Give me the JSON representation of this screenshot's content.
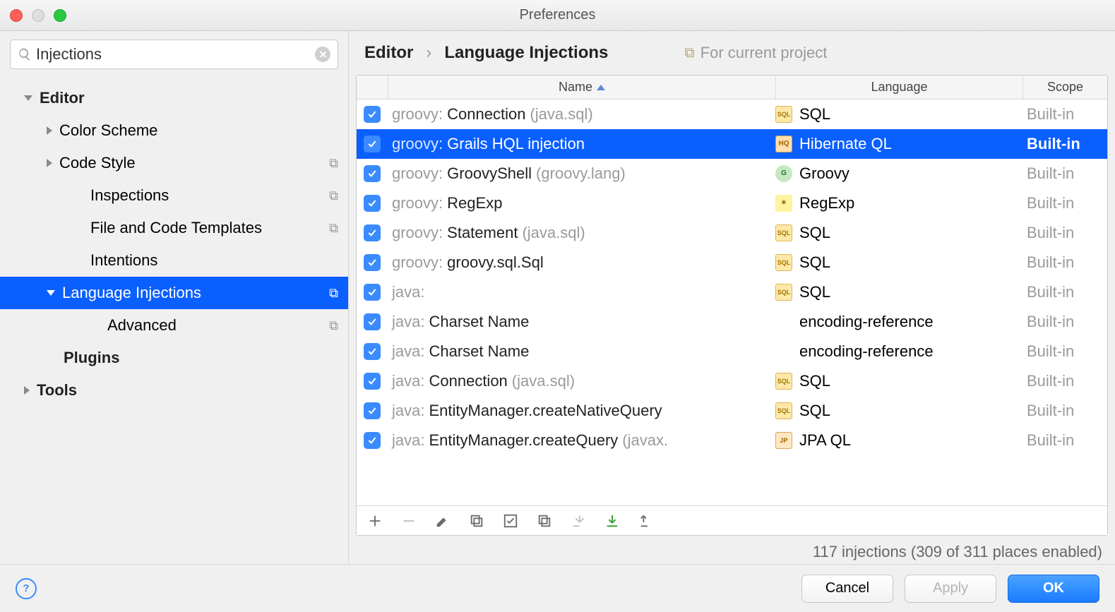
{
  "window": {
    "title": "Preferences"
  },
  "search": {
    "value": "Injections"
  },
  "tree": {
    "items": [
      {
        "label": "Editor",
        "bold": true,
        "arrow": "down",
        "indent": 0,
        "projIcon": false
      },
      {
        "label": "Color Scheme",
        "bold": false,
        "arrow": "right",
        "indent": 1,
        "projIcon": false
      },
      {
        "label": "Code Style",
        "bold": false,
        "arrow": "right",
        "indent": 1,
        "projIcon": true
      },
      {
        "label": "Inspections",
        "bold": false,
        "arrow": "none",
        "indent": 2,
        "projIcon": true
      },
      {
        "label": "File and Code Templates",
        "bold": false,
        "arrow": "none",
        "indent": 2,
        "projIcon": true
      },
      {
        "label": "Intentions",
        "bold": false,
        "arrow": "none",
        "indent": 2,
        "projIcon": false
      },
      {
        "label": "Language Injections",
        "bold": false,
        "arrow": "down",
        "indent": 1,
        "projIcon": true,
        "selected": true
      },
      {
        "label": "Advanced",
        "bold": false,
        "arrow": "none",
        "indent": 3,
        "projIcon": true
      },
      {
        "label": "Plugins",
        "bold": true,
        "arrow": "none",
        "indent": 0,
        "projIcon": false,
        "indentOverride": 1
      },
      {
        "label": "Tools",
        "bold": true,
        "arrow": "right",
        "indent": 0,
        "projIcon": false
      }
    ]
  },
  "breadcrumb": {
    "part1": "Editor",
    "part2": "Language Injections",
    "projectHint": "For current project"
  },
  "columns": {
    "name": "Name",
    "language": "Language",
    "scope": "Scope"
  },
  "rows": [
    {
      "prefix": "groovy:",
      "name": "Connection",
      "paren": "(java.sql)",
      "lang": "SQL",
      "icon": "sql",
      "scope": "Built-in"
    },
    {
      "prefix": "groovy:",
      "name": "Grails HQL injection",
      "paren": "",
      "lang": "Hibernate QL",
      "icon": "hql",
      "scope": "Built-in",
      "selected": true
    },
    {
      "prefix": "groovy:",
      "name": "GroovyShell",
      "paren": "(groovy.lang)",
      "lang": "Groovy",
      "icon": "groovy",
      "scope": "Built-in"
    },
    {
      "prefix": "groovy:",
      "name": "RegExp",
      "paren": "",
      "lang": "RegExp",
      "icon": "regex",
      "scope": "Built-in"
    },
    {
      "prefix": "groovy:",
      "name": "Statement",
      "paren": "(java.sql)",
      "lang": "SQL",
      "icon": "sql",
      "scope": "Built-in"
    },
    {
      "prefix": "groovy:",
      "name": "groovy.sql.Sql",
      "paren": "",
      "lang": "SQL",
      "icon": "sql",
      "scope": "Built-in"
    },
    {
      "prefix": "java:",
      "name": "",
      "paren": "",
      "lang": "SQL",
      "icon": "sql",
      "scope": "Built-in"
    },
    {
      "prefix": "java:",
      "name": "Charset Name",
      "paren": "",
      "lang": "encoding-reference",
      "icon": "none",
      "scope": "Built-in"
    },
    {
      "prefix": "java:",
      "name": "Charset Name",
      "paren": "",
      "lang": "encoding-reference",
      "icon": "none",
      "scope": "Built-in"
    },
    {
      "prefix": "java:",
      "name": "Connection",
      "paren": "(java.sql)",
      "lang": "SQL",
      "icon": "sql",
      "scope": "Built-in"
    },
    {
      "prefix": "java:",
      "name": "EntityManager.createNativeQuery",
      "paren": "",
      "lang": "SQL",
      "icon": "sql",
      "scope": "Built-in"
    },
    {
      "prefix": "java:",
      "name": "EntityManager.createQuery",
      "paren": "(javax.",
      "lang": "JPA QL",
      "icon": "jpa",
      "scope": "Built-in"
    }
  ],
  "status": "117 injections (309 of 311 places enabled)",
  "buttons": {
    "cancel": "Cancel",
    "apply": "Apply",
    "ok": "OK"
  },
  "iconText": {
    "sql": "SQL",
    "hql": "HQ",
    "groovy": "G",
    "regex": "✶",
    "jpa": "JP",
    "none": ""
  }
}
